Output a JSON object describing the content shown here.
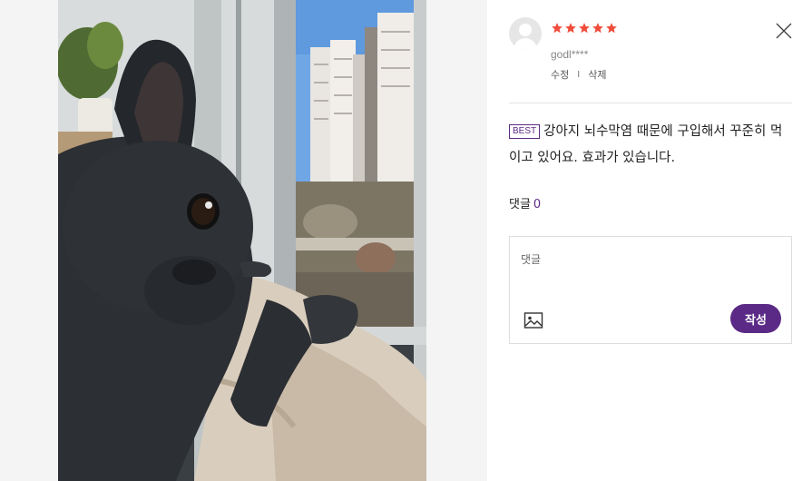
{
  "review": {
    "rating": 5,
    "rating_color": "#f04d3c",
    "username": "godl****",
    "edit_label": "수정",
    "separator": "I",
    "delete_label": "삭제",
    "badge": "BEST",
    "text": "강아지 뇌수막염 때문에 구입해서 꾸준히 먹이고 있어요. 효과가 있습니다."
  },
  "comments": {
    "label": "댓글",
    "count": "0",
    "input_placeholder": "댓글",
    "submit_label": "작성"
  },
  "icons": {
    "close": "close-icon",
    "image_attach": "image-icon",
    "avatar": "user-avatar-icon",
    "star": "star-icon"
  },
  "colors": {
    "accent": "#5b2a86",
    "star": "#f04d3c"
  }
}
